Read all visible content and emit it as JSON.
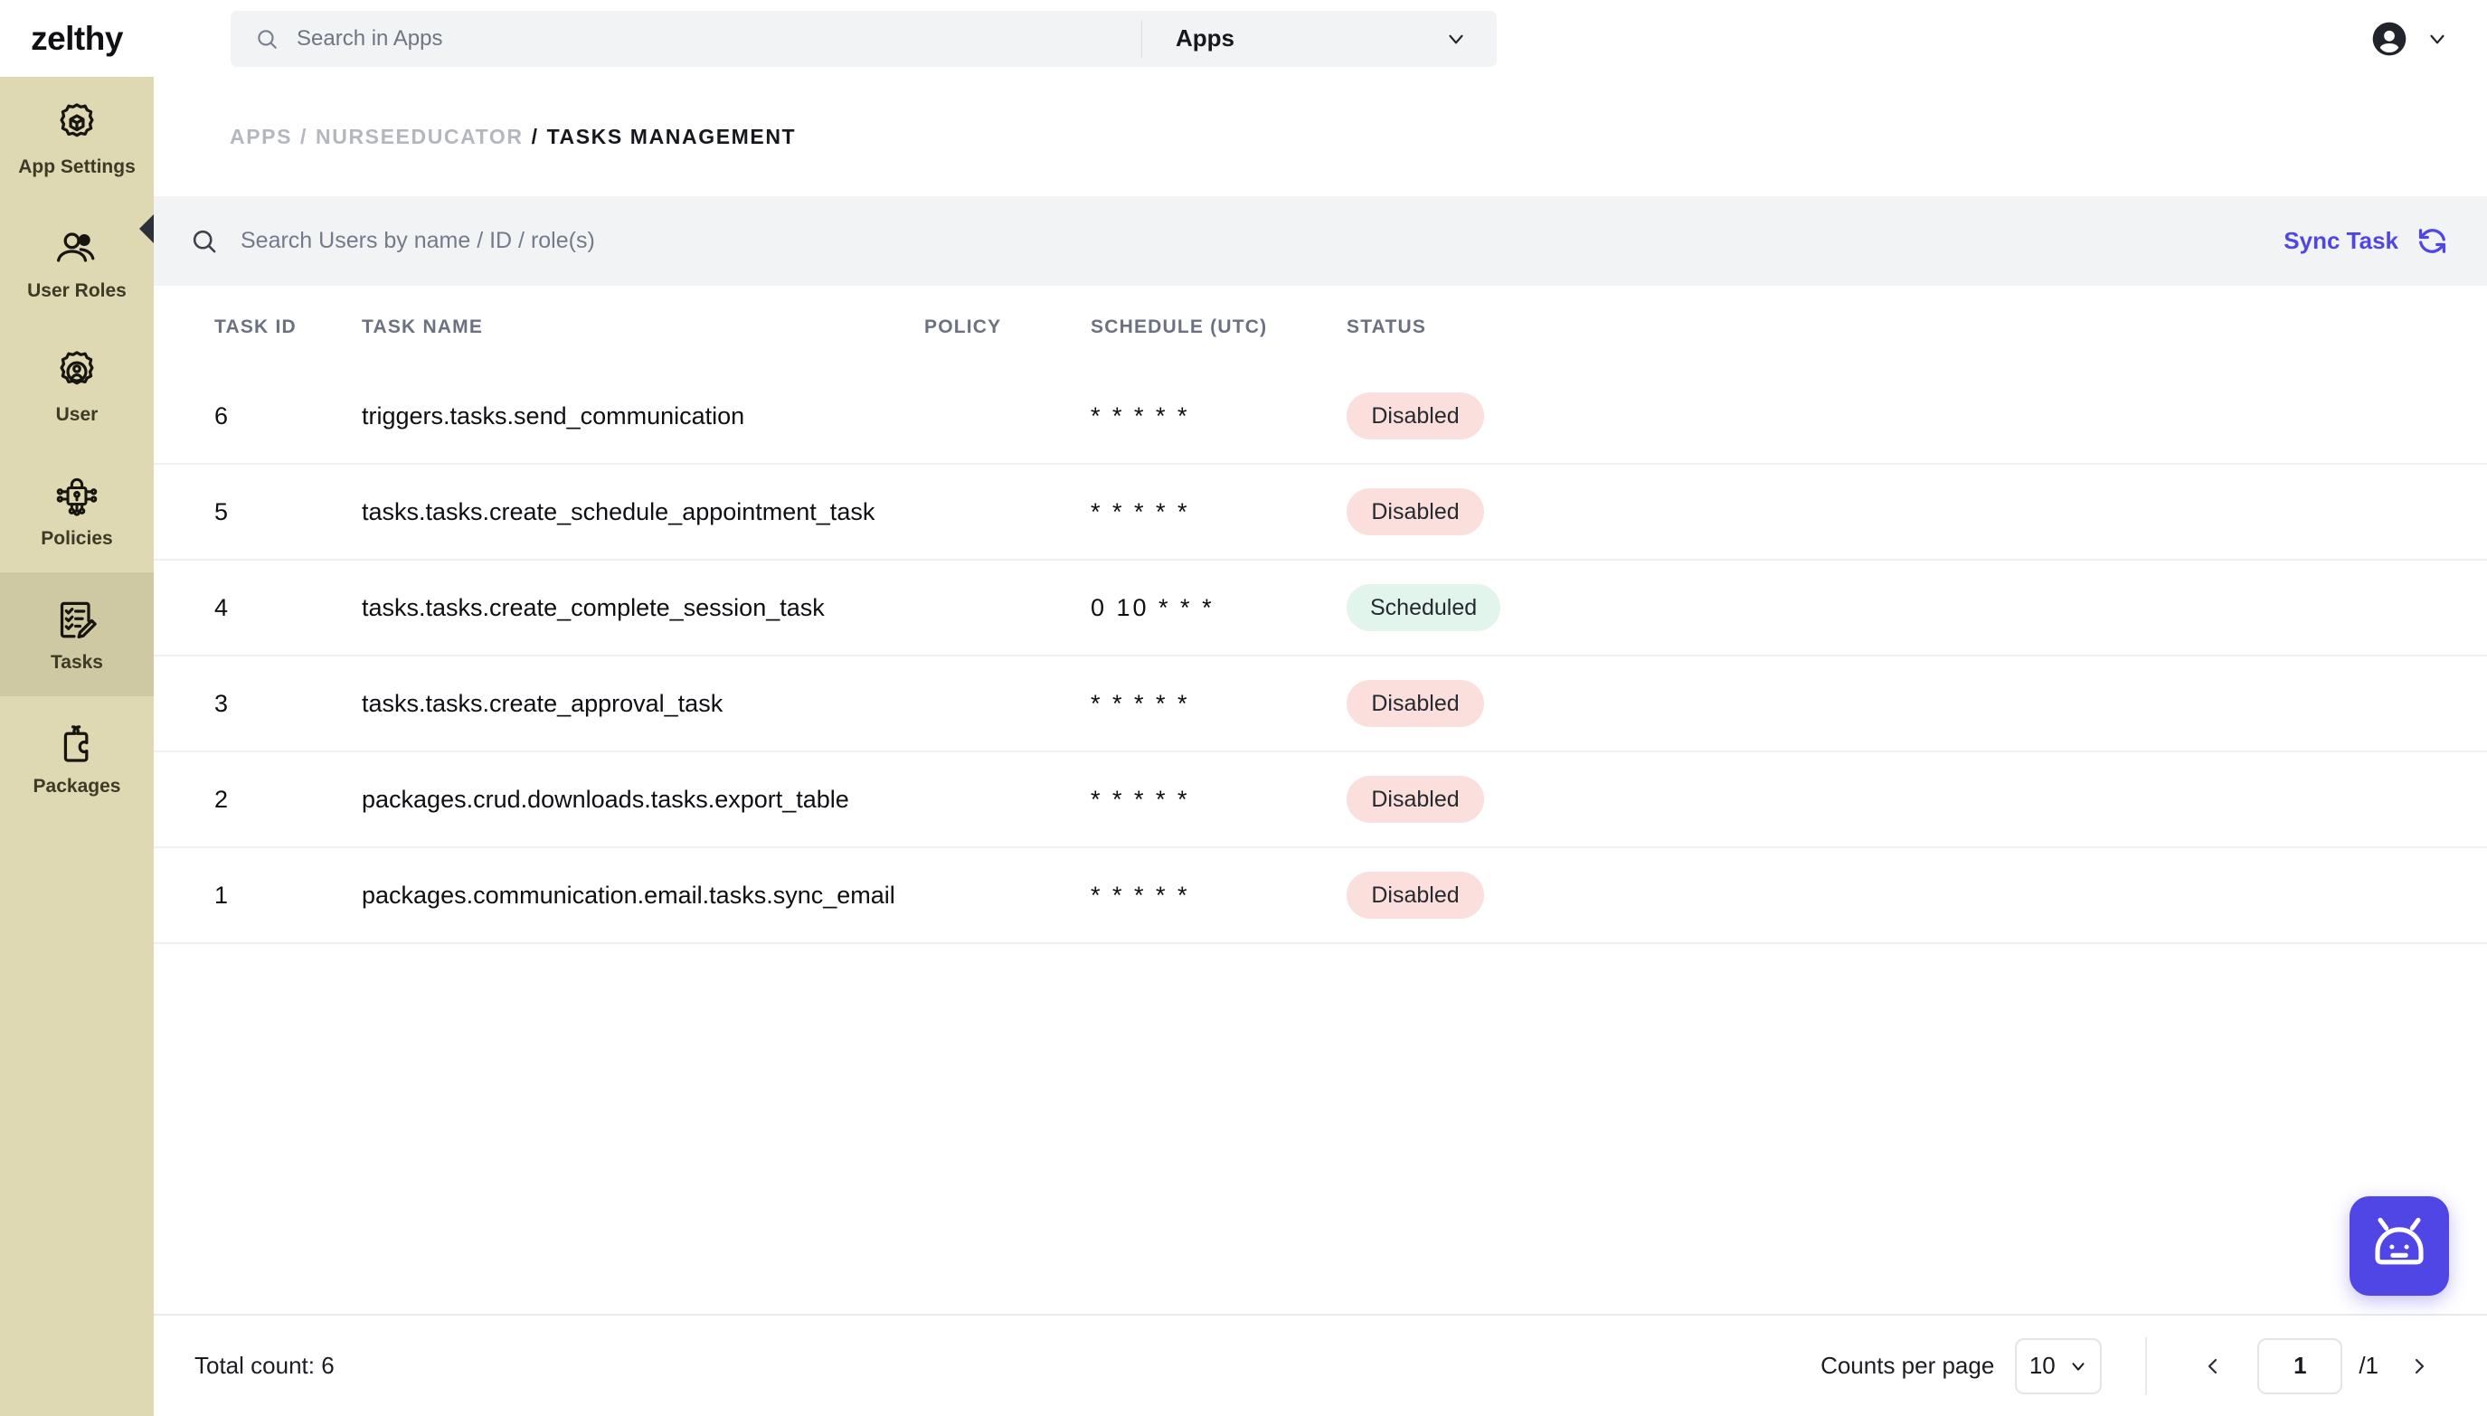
{
  "brand": {
    "name": "zelthy"
  },
  "global_search": {
    "placeholder": "Search in Apps",
    "scope_label": "Apps"
  },
  "sidebar": {
    "items": [
      {
        "label": "App Settings",
        "icon": "gear-cube-icon",
        "active": false
      },
      {
        "label": "User Roles",
        "icon": "users-icon",
        "active": false
      },
      {
        "label": "User",
        "icon": "gear-user-icon",
        "active": false
      },
      {
        "label": "Policies",
        "icon": "policy-lock-icon",
        "active": false
      },
      {
        "label": "Tasks",
        "icon": "checklist-pencil-icon",
        "active": true
      },
      {
        "label": "Packages",
        "icon": "puzzle-piece-icon",
        "active": false
      }
    ]
  },
  "breadcrumb": {
    "root": "APPS",
    "sep1": "/",
    "app": "NURSEEDUCATOR",
    "sep2": "/",
    "current": "TASKS MANAGEMENT"
  },
  "toolbar": {
    "search_placeholder": "Search Users by name / ID / role(s)",
    "search_value": "",
    "sync_label": "Sync Task"
  },
  "table": {
    "columns": [
      "TASK ID",
      "TASK NAME",
      "POLICY",
      "SCHEDULE (UTC)",
      "STATUS"
    ],
    "rows": [
      {
        "task_id": "6",
        "task_name": "triggers.tasks.send_communication",
        "policy": "",
        "schedule": "* * * * *",
        "status": "Disabled"
      },
      {
        "task_id": "5",
        "task_name": "tasks.tasks.create_schedule_appointment_task",
        "policy": "",
        "schedule": "* * * * *",
        "status": "Disabled"
      },
      {
        "task_id": "4",
        "task_name": "tasks.tasks.create_complete_session_task",
        "policy": "",
        "schedule": "0 10 * * *",
        "status": "Scheduled"
      },
      {
        "task_id": "3",
        "task_name": "tasks.tasks.create_approval_task",
        "policy": "",
        "schedule": "* * * * *",
        "status": "Disabled"
      },
      {
        "task_id": "2",
        "task_name": "packages.crud.downloads.tasks.export_table",
        "policy": "",
        "schedule": "* * * * *",
        "status": "Disabled"
      },
      {
        "task_id": "1",
        "task_name": "packages.communication.email.tasks.sync_email",
        "policy": "",
        "schedule": "* * * * *",
        "status": "Disabled"
      }
    ]
  },
  "footer": {
    "total_count": "Total count: 6",
    "counts_per_page_label": "Counts per page",
    "counts_per_page_value": "10",
    "page_value": "1",
    "page_total": "/1"
  },
  "fab": {
    "icon": "robot-icon"
  },
  "colors": {
    "sidebar": "#DED9B2",
    "sidebar_active": "#CFC9A3",
    "accent": "#4F46E5",
    "badge_disabled_bg": "#FADFDC",
    "badge_scheduled_bg": "#E1F5EC",
    "toolbar_bg": "#F2F3F5"
  }
}
